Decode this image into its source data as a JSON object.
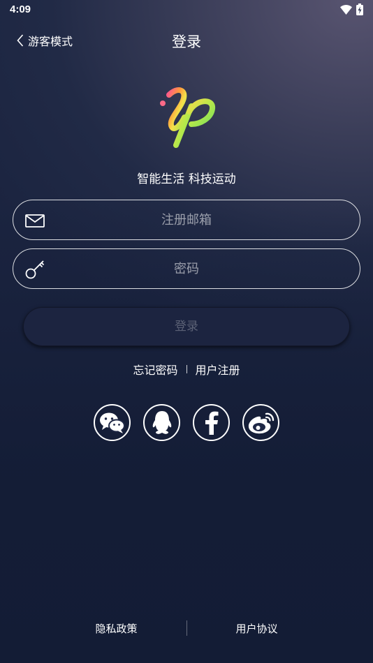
{
  "status_bar": {
    "time": "4:09"
  },
  "header": {
    "back_label": "游客模式",
    "title": "登录"
  },
  "slogan": "智能生活 科技运动",
  "form": {
    "email_placeholder": "注册邮箱",
    "password_placeholder": "密码",
    "login_label": "登录"
  },
  "links": {
    "forgot": "忘记密码",
    "register": "用户注册"
  },
  "social": [
    "wechat-icon",
    "qq-icon",
    "facebook-icon",
    "weibo-icon"
  ],
  "footer": {
    "privacy": "隐私政策",
    "agreement": "用户协议"
  },
  "colors": {
    "background": "#1b2440",
    "button": "#1c2440",
    "text": "#ffffff"
  }
}
